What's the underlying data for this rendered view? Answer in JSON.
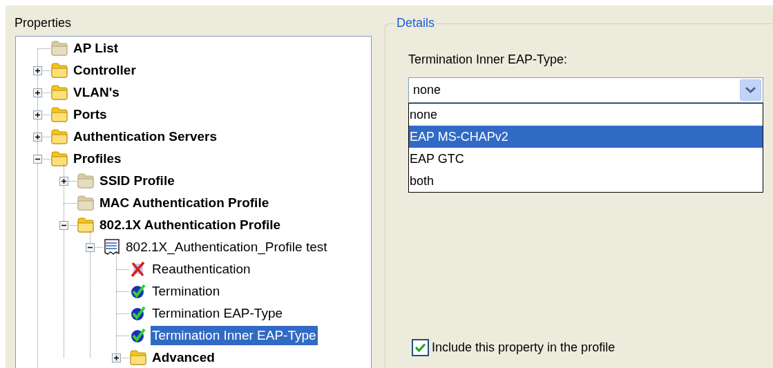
{
  "properties": {
    "title": "Properties",
    "tree": [
      {
        "label": "AP List",
        "kind": "folder_empty",
        "selected": false
      },
      {
        "label": "Controller",
        "kind": "folder",
        "expanded": false,
        "selected": false
      },
      {
        "label": "VLAN's",
        "kind": "folder",
        "expanded": false,
        "selected": false
      },
      {
        "label": "Ports",
        "kind": "folder",
        "expanded": false,
        "selected": false
      },
      {
        "label": "Authentication Servers",
        "kind": "folder",
        "expanded": false,
        "selected": false
      },
      {
        "label": "Profiles",
        "kind": "folder",
        "expanded": true,
        "selected": false,
        "children": [
          {
            "label": "SSID Profile",
            "kind": "folder_empty",
            "expanded": false,
            "selected": false
          },
          {
            "label": "MAC Authentication Profile",
            "kind": "folder_empty",
            "selected": false
          },
          {
            "label": "802.1X Authentication Profile",
            "kind": "folder",
            "expanded": true,
            "selected": false,
            "children": [
              {
                "label": "802.1X_Authentication_Profile test",
                "kind": "profile",
                "expanded": true,
                "selected": false,
                "children": [
                  {
                    "label": "Reauthentication",
                    "kind": "excluded",
                    "selected": false
                  },
                  {
                    "label": "Termination",
                    "kind": "included",
                    "selected": false
                  },
                  {
                    "label": "Termination EAP-Type",
                    "kind": "included",
                    "selected": false
                  },
                  {
                    "label": "Termination Inner EAP-Type",
                    "kind": "included",
                    "selected": true
                  },
                  {
                    "label": "Advanced",
                    "kind": "folder",
                    "expanded": false,
                    "selected": false
                  }
                ]
              }
            ]
          }
        ]
      }
    ]
  },
  "details": {
    "title": "Details",
    "field_label": "Termination Inner EAP-Type:",
    "value": "none",
    "options": [
      {
        "label": "none",
        "highlighted": false
      },
      {
        "label": "EAP MS-CHAPv2",
        "highlighted": true
      },
      {
        "label": "EAP GTC",
        "highlighted": false
      },
      {
        "label": "both",
        "highlighted": false
      }
    ],
    "include": {
      "label": "Include this property in the profile",
      "checked": true
    }
  }
}
